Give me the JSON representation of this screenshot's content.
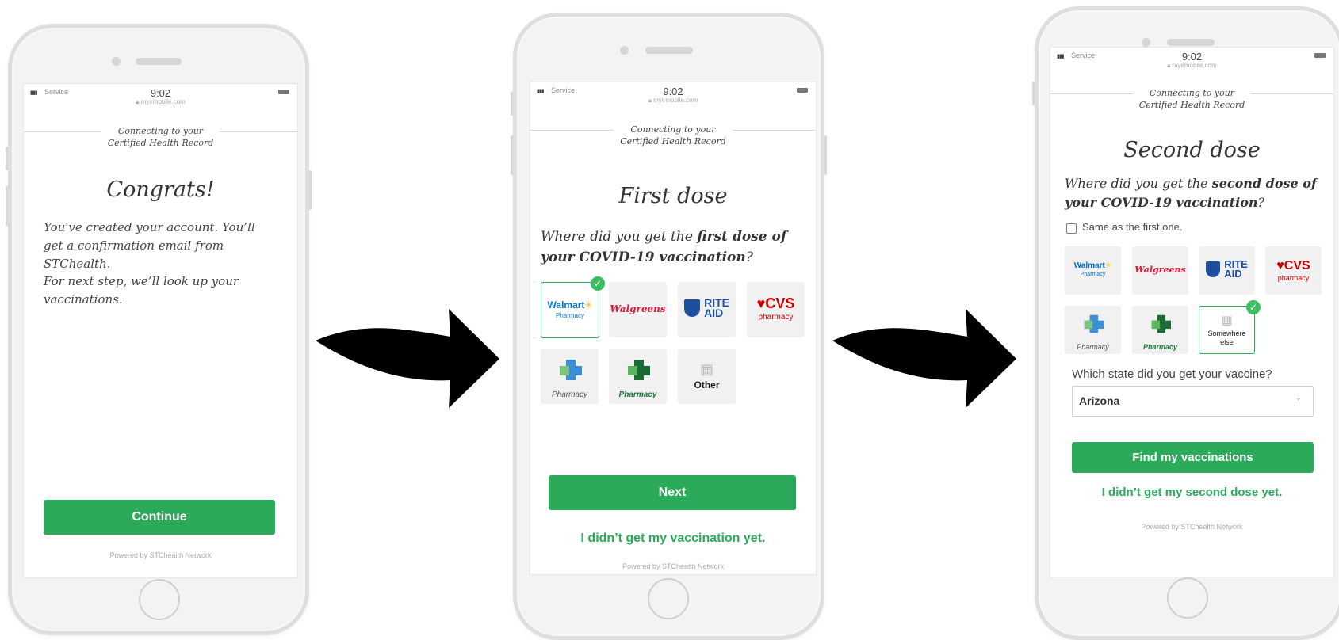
{
  "colors": {
    "brand_green": "#2bab5a",
    "check_green": "#3cbf63"
  },
  "status_bar": {
    "carrier": "Service",
    "time": "9:02",
    "url": "myirmobile.com"
  },
  "header_text": {
    "line1": "Connecting to your",
    "line2": "Certified Health Record"
  },
  "footer": "Powered by STChealth Network",
  "screen1": {
    "title": "Congrats!",
    "para1": "You've created your account. You’ll get a confirmation email from STChealth.",
    "para2": "For next step, we’ll look up your vaccinations.",
    "continue_label": "Continue"
  },
  "screen2": {
    "title": "First dose",
    "question_pre": "Where did you get the ",
    "question_bold": "first dose of your COVID-19 vaccination",
    "question_post": "?",
    "tiles": {
      "walmart_name": "Walmart",
      "walmart_sub": "Pharmacy",
      "walgreens": "Walgreens",
      "rite": "RITE",
      "aid": "AID",
      "cvs": "CVS",
      "cvs_sub": "pharmacy",
      "pharmacy_a": "Pharmacy",
      "pharmacy_b": "Pharmacy",
      "other": "Other"
    },
    "selected": "walmart",
    "next_label": "Next",
    "link": "I didn’t get my vaccination yet."
  },
  "screen3": {
    "title": "Second dose",
    "question_pre": "Where did you get  the ",
    "question_bold": "second dose of your COVID-19 vaccination",
    "question_post": "?",
    "same_checkbox": "Same as the first one.",
    "same_checked": false,
    "tiles": {
      "walmart_name": "Walmart",
      "walmart_sub": "Pharmacy",
      "walgreens": "Walgreens",
      "rite": "RITE",
      "aid": "AID",
      "cvs": "CVS",
      "cvs_sub": "pharmacy",
      "pharmacy_a": "Pharmacy",
      "pharmacy_b": "Pharmacy",
      "somewhere": "Somewhere else"
    },
    "selected": "somewhere-else",
    "state_question": "Which state did you get your vaccine?",
    "state_value": "Arizona",
    "find_label": "Find my vaccinations",
    "link": "I didn’t get my second dose yet."
  },
  "icons": [
    "signal-icon",
    "battery-icon",
    "lock-icon",
    "checkmark-icon",
    "building-icon",
    "chevron-down-icon",
    "arrow-right-icon"
  ]
}
